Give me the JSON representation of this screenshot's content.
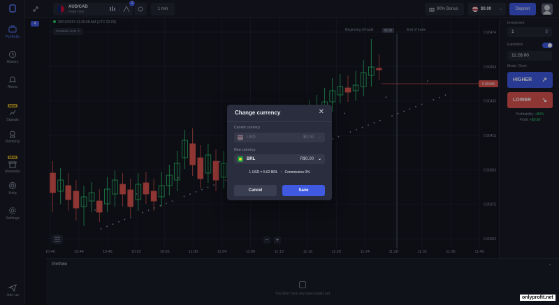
{
  "sidebar": {
    "notification_count": "4",
    "items": [
      {
        "label": "Portfolio",
        "icon": "portfolio-icon",
        "active": true
      },
      {
        "label": "History",
        "icon": "history-icon"
      },
      {
        "label": "Alerts",
        "icon": "alerts-icon"
      },
      {
        "label": "Signals",
        "icon": "signals-icon",
        "badge": "NEW"
      },
      {
        "label": "Ranking",
        "icon": "ranking-icon"
      },
      {
        "label": "Rewards",
        "icon": "rewards-icon",
        "badge": "NEW"
      },
      {
        "label": "Help",
        "icon": "help-icon"
      },
      {
        "label": "Settings",
        "icon": "settings-icon"
      }
    ],
    "join_us": "Join us"
  },
  "topbar": {
    "asset_name": "AUD/CAD",
    "asset_sub": "Fixed Time",
    "drawing_badge": "1",
    "timeframe": "1 min",
    "bonus": "90% Bonus",
    "balance": "$0.00",
    "deposit": "Deposit"
  },
  "chart": {
    "header": "09/10/2024 11:26:58 AM  (UTC 02:00)",
    "indicator": "Parabolic SAR",
    "beginning_label": "Beginning of trade",
    "beginning_time": "01:02",
    "end_label": "End of trade",
    "current_price": "0.90446"
  },
  "chart_data": {
    "type": "candlestick",
    "x_ticks": [
      "10:40",
      "10:44",
      "10:48",
      "10:52",
      "10:56",
      "11:00",
      "11:04",
      "11:08",
      "11:12",
      "11:16",
      "11:20",
      "11:24",
      "11:28",
      "11:32",
      "11:36",
      "11:40"
    ],
    "y_ticks": [
      "0.90474",
      "0.90454",
      "0.90433",
      "0.90413",
      "0.90393",
      "0.90372",
      "0.90352"
    ],
    "ylim": [
      0.90352,
      0.90474
    ]
  },
  "right_panel": {
    "investment_label": "Investment",
    "investment_value": "1",
    "investment_suffix": "$",
    "expiration_label": "Expiration",
    "expiration_value": "11:28:00",
    "mode_label": "Mode: Clock",
    "higher": "HIGHER",
    "lower": "LOWER",
    "profitability_label": "Profitability:",
    "profitability_value": "+80%",
    "profit_label": "Profit:",
    "profit_value": "+$0.80"
  },
  "portfolio": {
    "title": "Portfolio",
    "empty_text": "You don't have any open trades yet"
  },
  "modal": {
    "title": "Change currency",
    "current_label": "Current currency",
    "current_code": "USD",
    "current_balance": "$0.00",
    "new_label": "New currency",
    "new_code": "BRL",
    "new_balance": "R$0.00",
    "rate": "1 USD = 5.62 BRL",
    "commission": "Commission 0%",
    "cancel": "Cancel",
    "save": "Save"
  },
  "watermark": "onlyprofit.net",
  "colors": {
    "accent": "#3f5ae0",
    "up": "#2ecc71",
    "down": "#d9534f"
  }
}
